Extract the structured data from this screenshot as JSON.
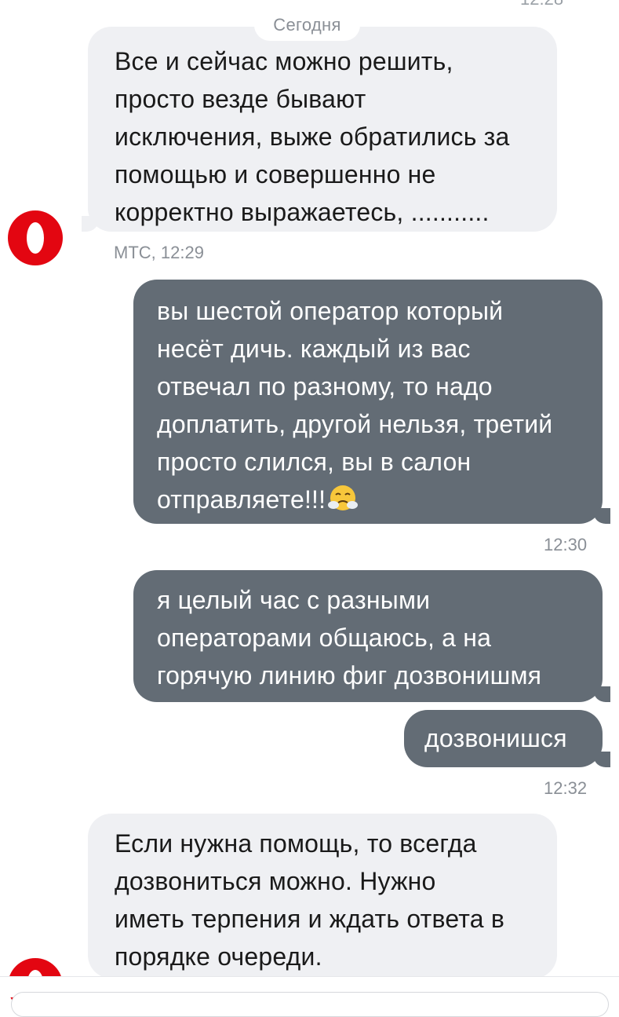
{
  "chat": {
    "top_time": "12:28",
    "date_separator": "Сегодня",
    "messages": [
      {
        "direction": "incoming",
        "lines": [
          "Все и сейчас можно решить,",
          "просто везде бывают",
          "исключения, выже обратились за",
          "помощью и совершенно не",
          "корректно выражаетесь, ..........."
        ],
        "meta": "МТС, 12:29"
      },
      {
        "direction": "outgoing",
        "lines": [
          "вы шестой оператор который",
          "несёт дичь. каждый из вас",
          "отвечал по разному, то надо",
          "доплатить, другой нельзя, третий",
          "просто слился, вы в салон",
          "отправляете!!!"
        ],
        "emoji": "steam-from-nose-emoji",
        "meta": "12:30"
      },
      {
        "direction": "outgoing",
        "lines": [
          "я целый час с разными",
          "операторами общаюсь, а на",
          "горячую линию фиг дозвонишмя"
        ]
      },
      {
        "direction": "outgoing",
        "lines": [
          "дозвонишся"
        ],
        "meta": "12:32"
      },
      {
        "direction": "incoming",
        "lines": [
          "Если нужна помощь, то всегда",
          "дозвониться можно. Нужно",
          "иметь терпения и ждать ответа в",
          "порядке очереди."
        ]
      }
    ]
  },
  "colors": {
    "incoming_bubble": "#eff0f3",
    "outgoing_bubble": "#636c75",
    "brand_red": "#e30611",
    "meta_text": "#8a8f96"
  },
  "icons": {
    "operator_avatar": "mts-egg-logo-icon"
  }
}
